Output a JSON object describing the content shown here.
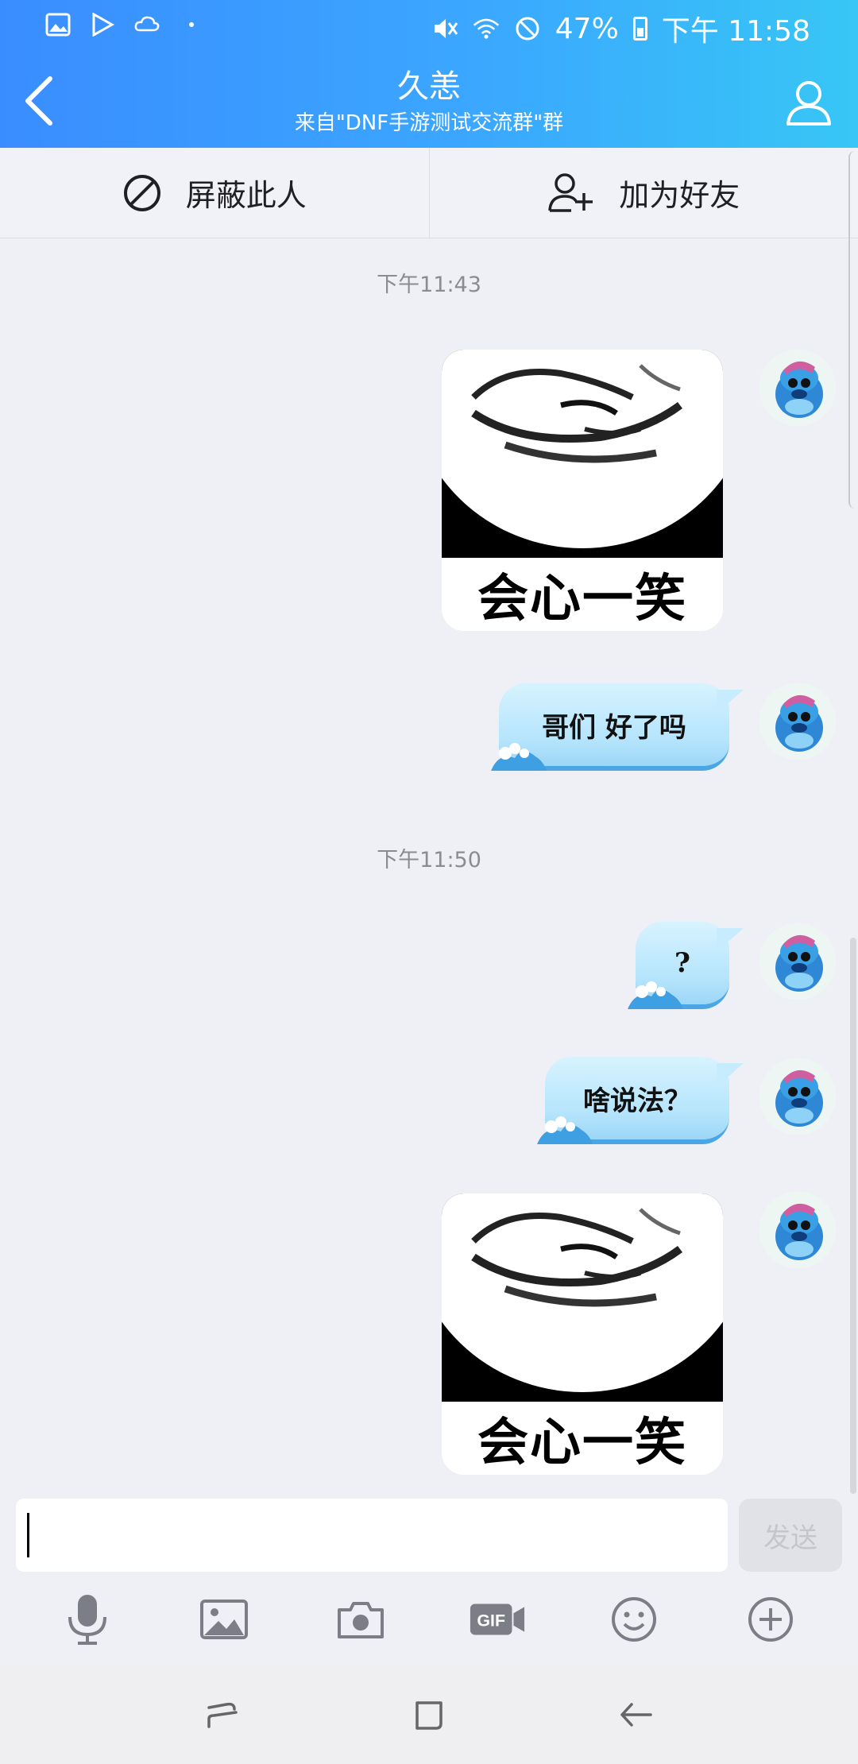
{
  "status_bar": {
    "battery": "47%",
    "time": "下午 11:58"
  },
  "header": {
    "title": "久恙",
    "subtitle": "来自\"DNF手游测试交流群\"群"
  },
  "actions": {
    "block_label": "屏蔽此人",
    "add_friend_label": "加为好友"
  },
  "chat": {
    "timestamp_1": "下午11:43",
    "timestamp_2": "下午11:50",
    "meme_caption": "会心一笑",
    "messages": [
      {
        "type": "sticker",
        "caption": "会心一笑"
      },
      {
        "type": "text",
        "text": "哥们 好了吗"
      },
      {
        "type": "text",
        "text": "?"
      },
      {
        "type": "text",
        "text": "啥说法？"
      },
      {
        "type": "sticker",
        "caption": "会心一笑"
      }
    ]
  },
  "input": {
    "send_label": "发送"
  },
  "toolbar": {
    "gif_label": "GIF"
  },
  "colors": {
    "header_start": "#3a8dff",
    "header_end": "#37c6f5",
    "bubble": "#b4e4fc",
    "background": "#eff0f5"
  }
}
